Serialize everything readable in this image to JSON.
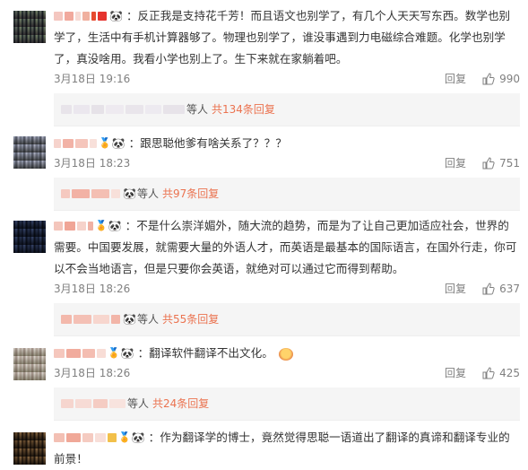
{
  "comments": [
    {
      "text": "：反正我是支持花千芳！而且语文也别学了，有几个人天天写东西。数学也别学了，生活中有手机计算器够了。物理也别学了，谁没事遇到力电磁综合难题。化学也别学了，真没啥用。我看小学也别上了。生下来就在家躺着吧。",
      "date": "3月18日 19:16",
      "reply_label": "回复",
      "likes": "990",
      "sub_prefix": "等人",
      "sub_link": "共134条回复"
    },
    {
      "text": "：跟思聪他爹有啥关系了？？？",
      "date": "3月18日 18:23",
      "reply_label": "回复",
      "likes": "751",
      "sub_prefix": "等人",
      "sub_link": "共97条回复"
    },
    {
      "text": "：不是什么崇洋媚外，随大流的趋势，而是为了让自己更加适应社会，世界的需要。中国要发展，就需要大量的外语人才，而英语是最基本的国际语言，在国外行走，你可以不会当地语言，但是只要你会英语，就绝对可以通过它而得到帮助。",
      "date": "3月18日 18:26",
      "reply_label": "回复",
      "likes": "637",
      "sub_prefix": "等人",
      "sub_link": "共55条回复"
    },
    {
      "text": "：翻译软件翻译不出文化。",
      "date": "3月18日 18:26",
      "reply_label": "回复",
      "likes": "425",
      "sub_prefix": "等人",
      "sub_link": "共24条回复"
    },
    {
      "text": "：作为翻译学的博士，竟然觉得思聪一语道出了翻译的真谛和翻译专业的前景！"
    }
  ],
  "colors": {
    "link": "#eb7350",
    "meta": "#808080",
    "sub_bg": "#f5f5f5"
  },
  "icons": {
    "like": "thumbs-up-icon",
    "panda": "panda-emoji-icon",
    "badge": "fan-badge-icon"
  }
}
